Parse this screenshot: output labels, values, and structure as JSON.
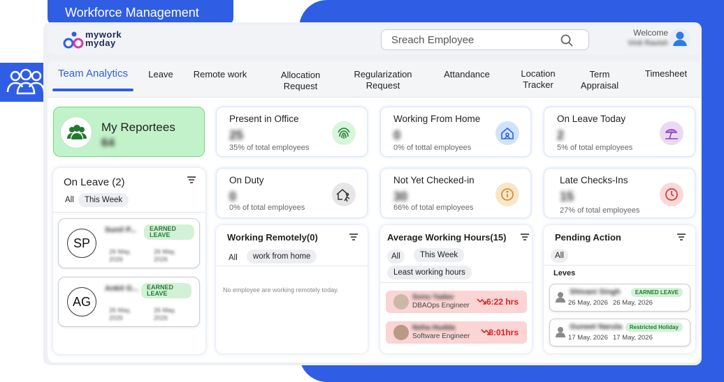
{
  "header_pill": "Workforce Management",
  "logo": {
    "line1": "mywork",
    "line2": "myday"
  },
  "search": {
    "placeholder": "Sreach Employee"
  },
  "user": {
    "welcome": "Welcome",
    "name": "Vinit Ravish"
  },
  "tabs": [
    {
      "label": "Team Analytics",
      "active": true
    },
    {
      "label": "Leave"
    },
    {
      "label": "Remote work"
    },
    {
      "label": "Allocation Request"
    },
    {
      "label": "Regularization Request"
    },
    {
      "label": "Attandance"
    },
    {
      "label": "Location Tracker"
    },
    {
      "label": "Term Appraisal"
    },
    {
      "label": "Timesheet"
    }
  ],
  "my_reportees": {
    "title": "My Reportees",
    "count": "64"
  },
  "stats": [
    {
      "label": "Present in Office",
      "value": "25",
      "sub": "35% of total employees",
      "icon": "fingerprint-icon",
      "color": "#d9f5dc"
    },
    {
      "label": "Working From Home",
      "value": "0",
      "sub": "0% of tottal employees",
      "icon": "home-icon",
      "color": "#cfe4fb"
    },
    {
      "label": "On Leave  Today",
      "value": "2",
      "sub": "5% of total employees",
      "icon": "beach-umbrella-icon",
      "color": "#ead9f6"
    },
    {
      "label": "On Duty",
      "value": "0",
      "sub": "0% of total employees",
      "icon": "house-walk-icon",
      "color": "#e6e6e6"
    },
    {
      "label": "Not Yet Checked-in",
      "value": "30",
      "sub": "66% of total employees",
      "icon": "info-icon",
      "color": "#f9e6c8"
    },
    {
      "label": "Late Checks-Ins",
      "value": "15",
      "sub": "27% of total employees",
      "icon": "clock-icon",
      "color": "#fbd8d8"
    }
  ],
  "on_leave": {
    "title": "On Leave (2)",
    "chips": [
      "All",
      "This Week"
    ],
    "items": [
      {
        "initials": "SP",
        "name": "Sunil P...",
        "from": "26 May,",
        "from_year": "2026",
        "to": "26 May,",
        "to_year": "2026",
        "badge": "EARNED LEAVE"
      },
      {
        "initials": "AG",
        "name": "Ankit G...",
        "from": "26 May,",
        "from_year": "2026",
        "to": "26 May,",
        "to_year": "2026",
        "badge": "EARNED LEAVE"
      }
    ]
  },
  "remote": {
    "title": "Working Remotely(0)",
    "chips": [
      "All",
      "work from home"
    ],
    "empty": "No employee are working remotely today."
  },
  "avg_hours": {
    "title": "Average Working Hours(15)",
    "chips": [
      "All",
      "This Week",
      "Least working hours"
    ],
    "items": [
      {
        "name": "Sonu Yadav",
        "role": "DBAOps Engineer",
        "hours": "6:22 hrs"
      },
      {
        "name": "Neha Hudda",
        "role": "Software Engineer",
        "hours": "8:01hrs"
      }
    ]
  },
  "pending": {
    "title": "Pending Action",
    "chips": [
      "All"
    ],
    "section": "Leves",
    "items": [
      {
        "name": "Shivani Singh",
        "badge": "EARNED LEAVE",
        "from": "26 May, 2026",
        "to": "26 May, 2026"
      },
      {
        "name": "Guneet Narula",
        "badge": "Restricted Holiday",
        "from": "17 May, 2026",
        "to": "17 May, 2026"
      }
    ]
  },
  "colors": {
    "brand": "#2f5ee4",
    "green": "#c2f2c9",
    "red": "#e02020"
  }
}
